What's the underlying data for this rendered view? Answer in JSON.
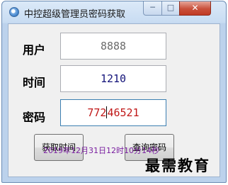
{
  "window": {
    "title": "中控超级管理员密码获取",
    "controls": {
      "minimize": "─",
      "maximize": "□",
      "close": "✕"
    }
  },
  "form": {
    "user": {
      "label": "用户",
      "value": "8888",
      "color": "#6b6b6b"
    },
    "time": {
      "label": "时间",
      "value": "1210",
      "color": "#14147a"
    },
    "password": {
      "label": "密码",
      "value_before_caret": "772",
      "value_after_caret": "46521",
      "color": "#c01818"
    }
  },
  "buttons": {
    "get_time": "获取时间",
    "query_password": "查询密码"
  },
  "status": {
    "text": "2019年12月31日12时10分14秒"
  },
  "watermark": {
    "text": "最需教育"
  },
  "icons": {
    "app": "app-icon"
  }
}
